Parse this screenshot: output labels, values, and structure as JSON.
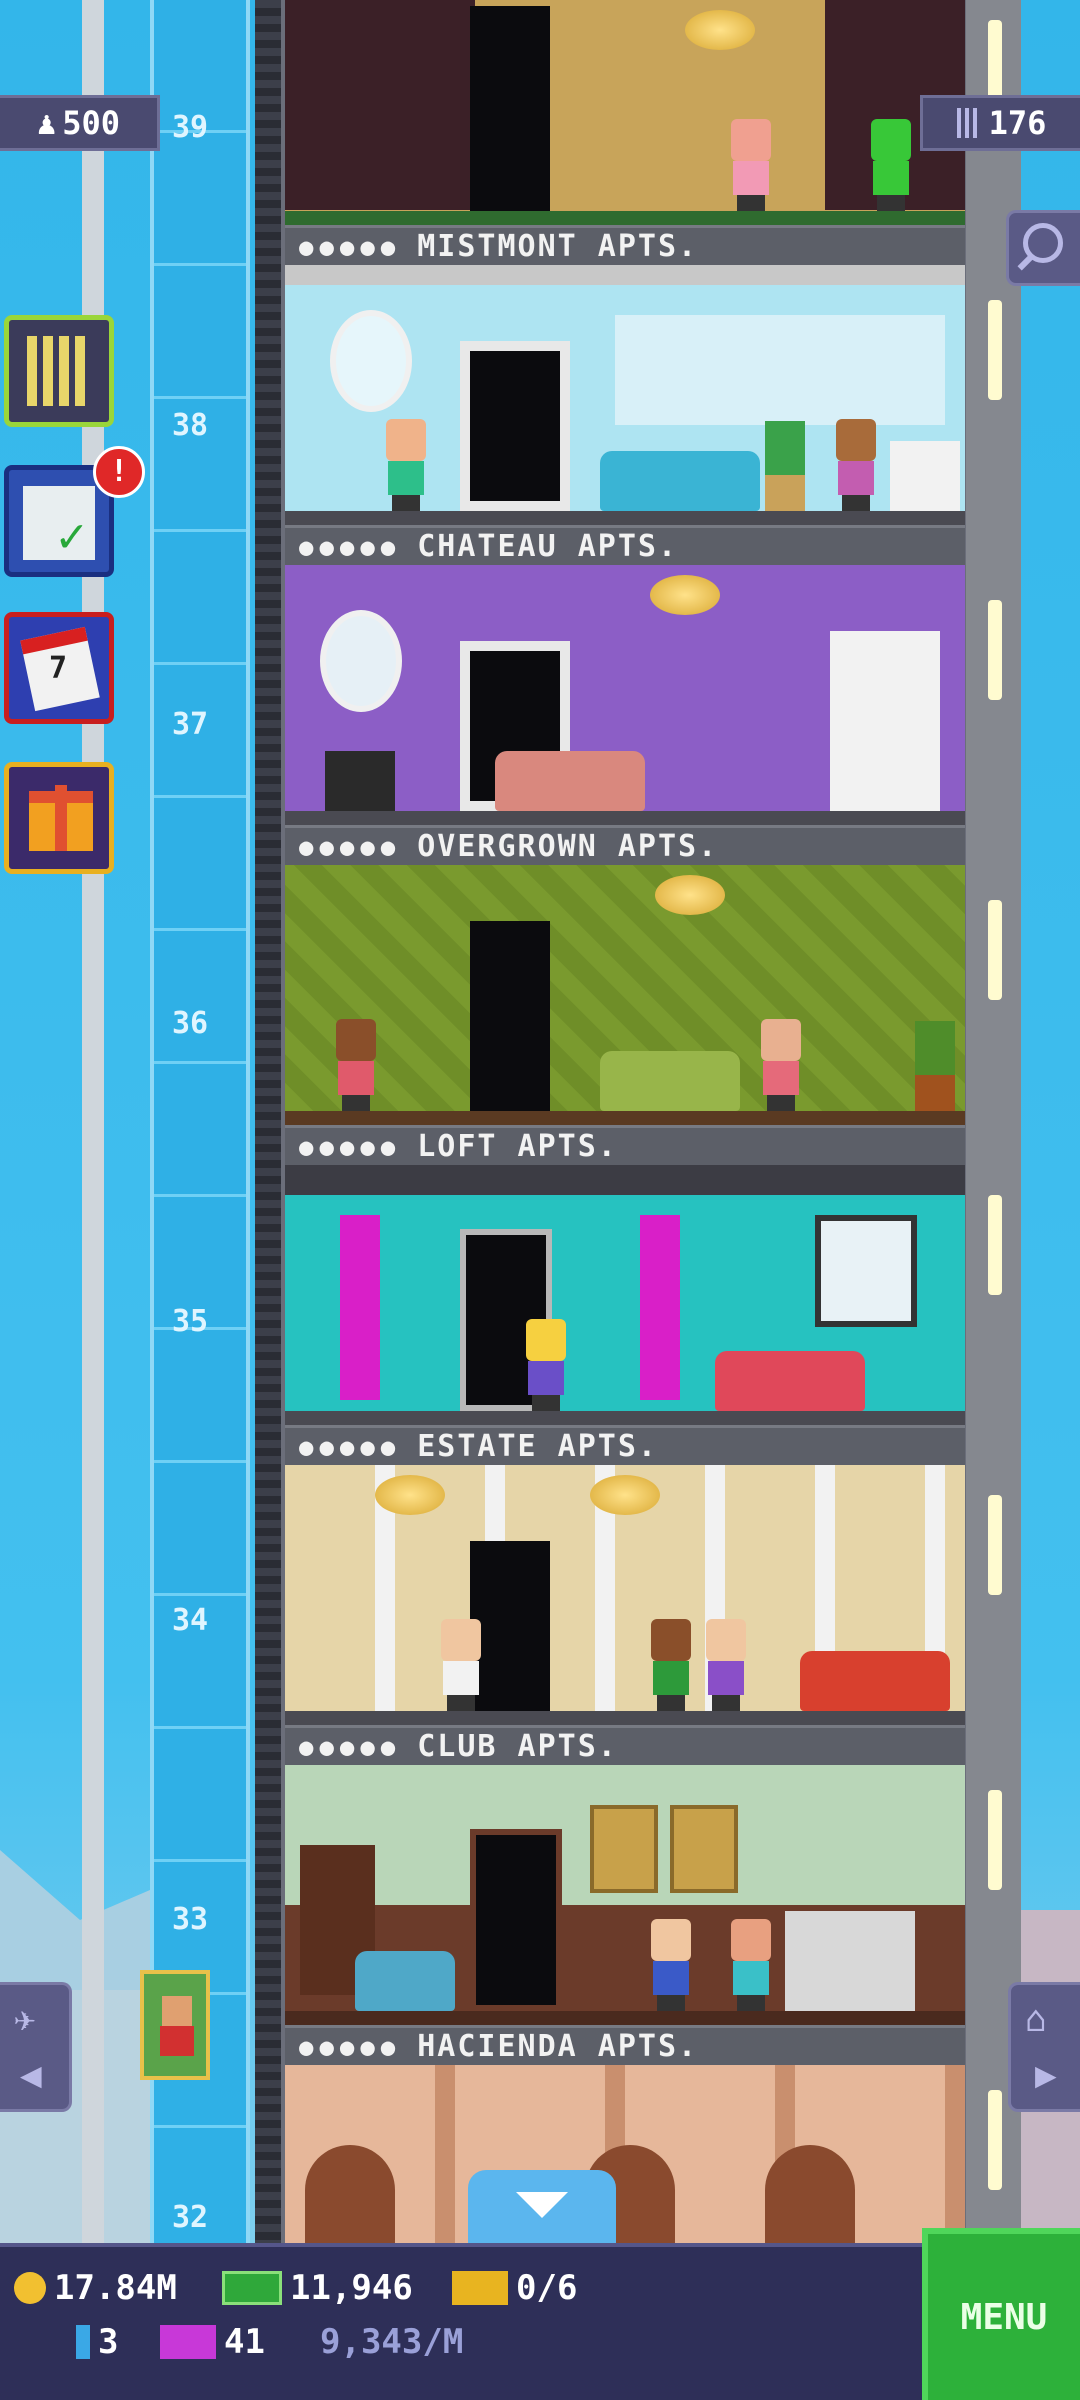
{
  "header": {
    "population": "500",
    "population_icon": "person-icon",
    "floors": "176",
    "floors_icon": "building-icon"
  },
  "floor_numbers": [
    "39",
    "38",
    "37",
    "36",
    "35",
    "34",
    "33",
    "32"
  ],
  "floors": [
    {
      "name": "MISTMONT APTS.",
      "people": "●●●●●"
    },
    {
      "name": "CHATEAU APTS.",
      "people": "●●●●●"
    },
    {
      "name": "OVERGROWN APTS.",
      "people": "●●●●●"
    },
    {
      "name": "LOFT APTS.",
      "people": "●●●●●"
    },
    {
      "name": "ESTATE APTS.",
      "people": "●●●●●"
    },
    {
      "name": "CLUB APTS.",
      "people": "●●●●●"
    },
    {
      "name": "HACIENDA APTS.",
      "people": "●●●●●"
    }
  ],
  "side_buttons": [
    {
      "icon": "building-grid-icon"
    },
    {
      "icon": "checklist-icon",
      "badge": "!"
    },
    {
      "icon": "calendar-icon",
      "text": "7"
    },
    {
      "icon": "gift-icon"
    }
  ],
  "bottom": {
    "coins": "17.84M",
    "bux": "11,946",
    "tickets": "0/6",
    "keys": "3",
    "vip": "41",
    "rate": "9,343/M",
    "menu_label": "MENU"
  },
  "colors": {
    "sky": "#35b7ea",
    "bar": "#2e2f58",
    "menu": "#2db13a"
  }
}
